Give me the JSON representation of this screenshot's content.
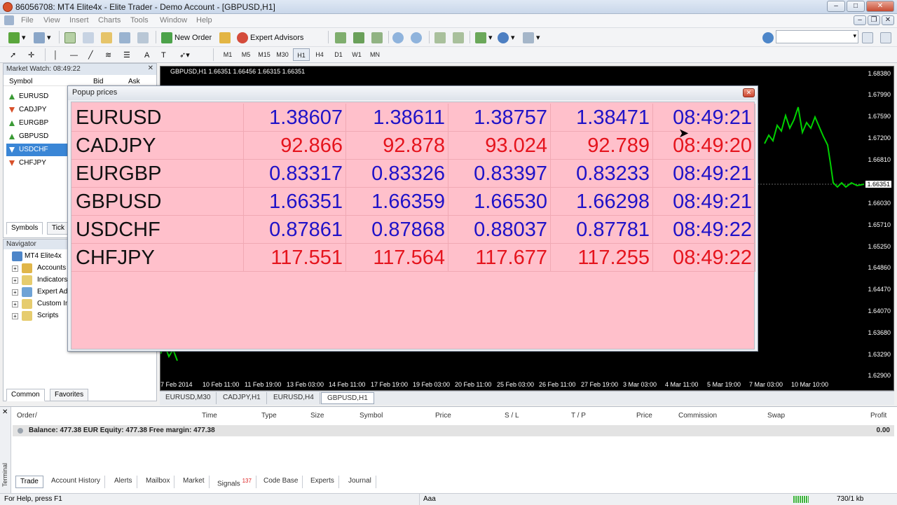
{
  "window": {
    "title": "86056708: MT4 Elite4x - Elite Trader - Demo Account - [GBPUSD,H1]"
  },
  "menu": [
    "File",
    "View",
    "Insert",
    "Charts",
    "Tools",
    "Window",
    "Help"
  ],
  "toolbar": {
    "new_order": "New Order",
    "expert_advisors": "Expert Advisors"
  },
  "timeframes": [
    "M1",
    "M5",
    "M15",
    "M30",
    "H1",
    "H4",
    "D1",
    "W1",
    "MN"
  ],
  "market_watch": {
    "title": "Market Watch: 08:49:22",
    "cols": {
      "symbol": "Symbol",
      "bid": "Bid",
      "ask": "Ask"
    },
    "rows": [
      {
        "symbol": "EURUSD",
        "dir": "up"
      },
      {
        "symbol": "CADJPY",
        "dir": "down"
      },
      {
        "symbol": "EURGBP",
        "dir": "up"
      },
      {
        "symbol": "GBPUSD",
        "dir": "up"
      },
      {
        "symbol": "USDCHF",
        "dir": "down"
      },
      {
        "symbol": "CHFJPY",
        "dir": "down"
      }
    ],
    "tabs": [
      "Symbols",
      "Tick"
    ]
  },
  "navigator": {
    "title": "Navigator",
    "root": "MT4 Elite4x",
    "items": [
      "Accounts",
      "Indicators",
      "Expert Advisors",
      "Custom Indicators",
      "Scripts"
    ],
    "tabs": [
      "Common",
      "Favorites"
    ]
  },
  "chart": {
    "info": "GBPUSD,H1  1.66351 1.66456 1.66315 1.66351",
    "y_labels": [
      "1.68380",
      "1.67990",
      "1.67590",
      "1.67200",
      "1.66810",
      "1.66030",
      "1.65710",
      "1.65250",
      "1.64860",
      "1.64470",
      "1.64070",
      "1.63680",
      "1.63290",
      "1.62900"
    ],
    "current_price": "1.66351",
    "x_labels": [
      "7 Feb 2014",
      "10 Feb 11:00",
      "11 Feb 19:00",
      "13 Feb 03:00",
      "14 Feb 11:00",
      "17 Feb 19:00",
      "19 Feb 03:00",
      "20 Feb 11:00",
      "25 Feb 03:00",
      "26 Feb 11:00",
      "27 Feb 19:00",
      "3 Mar 03:00",
      "4 Mar 11:00",
      "5 Mar 19:00",
      "7 Mar 03:00",
      "10 Mar 10:00"
    ]
  },
  "chart_tabs": [
    "EURUSD,M30",
    "CADJPY,H1",
    "EURUSD,H4",
    "GBPUSD,H1"
  ],
  "popup": {
    "title": "Popup prices",
    "rows": [
      {
        "symbol": "EURUSD",
        "v1": "1.38607",
        "v2": "1.38611",
        "v3": "1.38757",
        "v4": "1.38471",
        "time": "08:49:21",
        "color": "#1f12c8"
      },
      {
        "symbol": "CADJPY",
        "v1": "92.866",
        "v2": "92.878",
        "v3": "93.024",
        "v4": "92.789",
        "time": "08:49:20",
        "color": "#e5141d"
      },
      {
        "symbol": "EURGBP",
        "v1": "0.83317",
        "v2": "0.83326",
        "v3": "0.83397",
        "v4": "0.83233",
        "time": "08:49:21",
        "color": "#1f12c8"
      },
      {
        "symbol": "GBPUSD",
        "v1": "1.66351",
        "v2": "1.66359",
        "v3": "1.66530",
        "v4": "1.66298",
        "time": "08:49:21",
        "color": "#1f12c8"
      },
      {
        "symbol": "USDCHF",
        "v1": "0.87861",
        "v2": "0.87868",
        "v3": "0.88037",
        "v4": "0.87781",
        "time": "08:49:22",
        "color": "#1f12c8"
      },
      {
        "symbol": "CHFJPY",
        "v1": "117.551",
        "v2": "117.564",
        "v3": "117.677",
        "v4": "117.255",
        "time": "08:49:22",
        "color": "#e5141d"
      }
    ]
  },
  "terminal": {
    "side_label": "Terminal",
    "headers": [
      "Order",
      "Time",
      "Type",
      "Size",
      "Symbol",
      "Price",
      "S / L",
      "T / P",
      "Price",
      "Commission",
      "Swap",
      "Profit"
    ],
    "balance": "Balance: 477.38 EUR  Equity: 477.38  Free margin: 477.38",
    "profit": "0.00",
    "tabs": [
      "Trade",
      "Account History",
      "Alerts",
      "Mailbox",
      "Market",
      "Signals",
      "Code Base",
      "Experts",
      "Journal"
    ],
    "signals_badge": "137"
  },
  "status": {
    "help": "For Help, press F1",
    "font": "Aaa",
    "traffic": "730/1 kb"
  }
}
